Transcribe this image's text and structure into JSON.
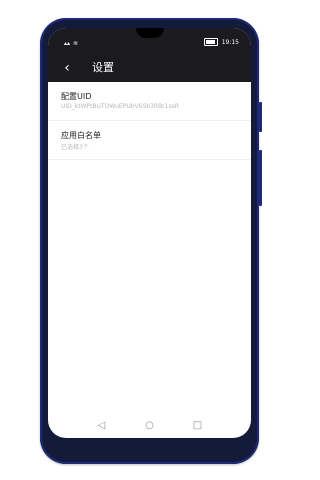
{
  "status_bar": {
    "left_icons": [
      "signal-icon",
      "wifi-icon"
    ],
    "battery_icon": "battery-icon",
    "time": "19:15"
  },
  "app_bar": {
    "title": "设置",
    "back_icon": "chevron-left-icon"
  },
  "settings": [
    {
      "title": "配置UID",
      "subtitle": "UID_ktWPtBUTOWuEPUbV6Sb3RBr1ssR"
    },
    {
      "title": "应用白名单",
      "subtitle": "已选择3个"
    }
  ],
  "nav_bar": {
    "back_icon": "triangle-back-icon",
    "home_icon": "circle-home-icon",
    "recent_icon": "square-recent-icon"
  },
  "colors": {
    "phone_body": "#131a3a",
    "phone_trim": "#1e2a78",
    "app_bar": "#1b1b1f",
    "subtitle": "#b7b7b7"
  }
}
